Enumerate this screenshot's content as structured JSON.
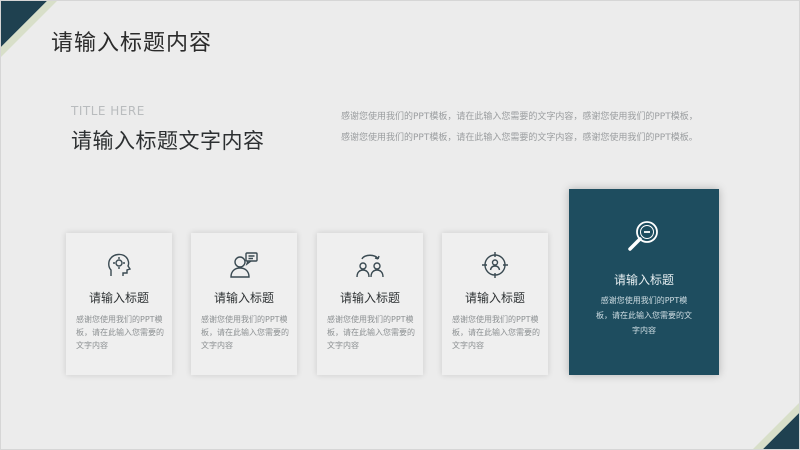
{
  "header": {
    "title": "请输入标题内容"
  },
  "section": {
    "eyebrow": "TITLE HERE",
    "title": "请输入标题文字内容",
    "intro": "感谢您使用我们的PPT模板，请在此输入您需要的文字内容，感谢您使用我们的PPT模板，感谢您使用我们的PPT模板，请在此输入您需要的文字内容，感谢您使用我们的PPT模板。"
  },
  "cards": [
    {
      "icon": "gear-head-icon",
      "title": "请输入标题",
      "text": "感谢您使用我们的PPT模板，请在此输入您需要的文字内容"
    },
    {
      "icon": "user-chat-icon",
      "title": "请输入标题",
      "text": "感谢您使用我们的PPT模板，请在此输入您需要的文字内容"
    },
    {
      "icon": "people-exchange-icon",
      "title": "请输入标题",
      "text": "感谢您使用我们的PPT模板，请在此输入您需要的文字内容"
    },
    {
      "icon": "target-person-icon",
      "title": "请输入标题",
      "text": "感谢您使用我们的PPT模板，请在此输入您需要的文字内容"
    }
  ],
  "featured": {
    "icon": "magnifier-icon",
    "title": "请输入标题",
    "text": "感谢您使用我们的PPT模板，请在此输入您需要的文字内容"
  },
  "colors": {
    "accent": "#1e4d5f",
    "corner_dark": "#1f4150",
    "corner_light": "#d8dfc9"
  }
}
